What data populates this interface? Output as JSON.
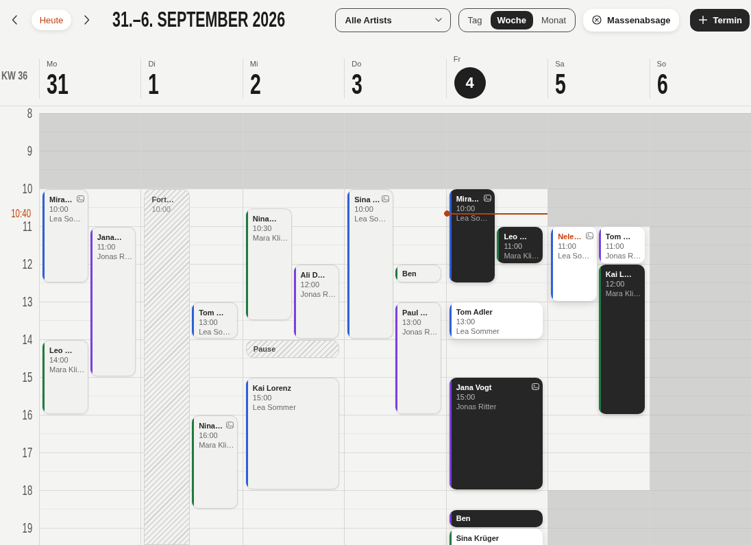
{
  "toolbar": {
    "today_button": "Heute",
    "title": "31.–6. SEPTEMBER 2026",
    "artist_filter": {
      "value": "Alle Artists"
    },
    "views": [
      {
        "label": "Tag",
        "selected": false
      },
      {
        "label": "Woche",
        "selected": true
      },
      {
        "label": "Monat",
        "selected": false
      }
    ],
    "cancel_button": "Massenabsage",
    "add_button": "Termin"
  },
  "week_label": "KW 36",
  "hours": [
    "8",
    "9",
    "10",
    "11",
    "12",
    "13",
    "14",
    "15",
    "16",
    "17",
    "18",
    "19"
  ],
  "now": {
    "label": "10:40"
  },
  "days": [
    {
      "weekday": "Mo",
      "date": "31",
      "selected": false,
      "closed_hours": [
        true,
        true,
        false,
        false,
        false,
        false,
        false,
        false,
        false,
        false,
        false,
        false
      ],
      "events": [
        {
          "kind": "past",
          "title": "Mira…",
          "time": "10:00",
          "artist": "Lea So…",
          "color": "#2d5fd8",
          "photo": true,
          "flagged": false
        },
        {
          "kind": "past",
          "title": "Jana…",
          "time": "11:00",
          "artist": "Jonas R…",
          "color": "#7b3fe0",
          "photo": false,
          "flagged": false
        },
        {
          "kind": "past",
          "title": "Leo …",
          "time": "14:00",
          "artist": "Mara Kli…",
          "color": "#1f7a3f",
          "photo": false,
          "flagged": false
        }
      ]
    },
    {
      "weekday": "Di",
      "date": "1",
      "selected": false,
      "closed_hours": [
        true,
        true,
        false,
        false,
        false,
        false,
        false,
        false,
        false,
        false,
        false,
        false
      ],
      "events": [
        {
          "kind": "blocked",
          "title": "Fort…",
          "time": "10:00",
          "photo": false,
          "flagged": false
        },
        {
          "kind": "past",
          "title": "Tom …",
          "time": "13:00",
          "artist": "Lea So…",
          "color": "#2d5fd8",
          "photo": false,
          "flagged": false
        },
        {
          "kind": "past",
          "title": "Nina…",
          "time": "16:00",
          "artist": "Mara Kli…",
          "color": "#1f7a3f",
          "photo": true,
          "flagged": false
        }
      ]
    },
    {
      "weekday": "Mi",
      "date": "2",
      "selected": false,
      "closed_hours": [
        true,
        true,
        false,
        false,
        false,
        false,
        false,
        false,
        false,
        false,
        false,
        false
      ],
      "events": [
        {
          "kind": "past",
          "title": "Nina…",
          "time": "10:30",
          "artist": "Mara Kli…",
          "color": "#1f7a3f",
          "photo": false,
          "flagged": false
        },
        {
          "kind": "past",
          "title": "Ali D…",
          "time": "12:00",
          "artist": "Jonas R…",
          "color": "#7b3fe0",
          "photo": false,
          "flagged": false
        },
        {
          "kind": "blocked",
          "title": "Pause",
          "photo": false,
          "flagged": false
        },
        {
          "kind": "past",
          "title": "Kai Lorenz",
          "time": "15:00",
          "artist": "Lea Sommer",
          "color": "#2d5fd8",
          "photo": false,
          "flagged": false
        }
      ]
    },
    {
      "weekday": "Do",
      "date": "3",
      "selected": false,
      "closed_hours": [
        true,
        true,
        false,
        false,
        false,
        false,
        false,
        false,
        false,
        false,
        false,
        false
      ],
      "events": [
        {
          "kind": "past",
          "title": "Sina …",
          "time": "10:00",
          "artist": "Lea So…",
          "color": "#2d5fd8",
          "photo": true,
          "flagged": false
        },
        {
          "kind": "past",
          "title": "Ben",
          "color": "#1f7a3f",
          "photo": false,
          "flagged": false
        },
        {
          "kind": "past",
          "title": "Paul …",
          "time": "13:00",
          "artist": "Jonas R…",
          "color": "#7b3fe0",
          "photo": false,
          "flagged": false
        }
      ]
    },
    {
      "weekday": "Fr",
      "date": "4",
      "selected": true,
      "closed_hours": [
        true,
        true,
        false,
        false,
        false,
        false,
        false,
        false,
        false,
        false,
        false,
        false
      ],
      "events": [
        {
          "kind": "confirmed",
          "title": "Mira…",
          "time": "10:00",
          "artist": "Lea So…",
          "color": "#2d5fd8",
          "photo": true,
          "flagged": false
        },
        {
          "kind": "confirmed",
          "title": "Leo …",
          "time": "11:00",
          "artist": "Mara Kli…",
          "color": "#1f7a3f",
          "photo": false,
          "flagged": false
        },
        {
          "kind": "pending",
          "title": "Tom Adler",
          "time": "13:00",
          "artist": "Lea Sommer",
          "color": "#2d5fd8",
          "photo": false,
          "flagged": false
        },
        {
          "kind": "confirmed",
          "title": "Jana Vogt",
          "time": "15:00",
          "artist": "Jonas Ritter",
          "color": "#7b3fe0",
          "photo": true,
          "flagged": false
        },
        {
          "kind": "confirmed",
          "title": "Ben",
          "color": "#7b3fe0",
          "photo": false,
          "flagged": false
        },
        {
          "kind": "pending",
          "title": "Sina Krüger",
          "color": "#1f7a3f",
          "photo": false,
          "flagged": false
        }
      ]
    },
    {
      "weekday": "Sa",
      "date": "5",
      "selected": false,
      "closed_hours": [
        true,
        true,
        true,
        false,
        false,
        false,
        false,
        false,
        false,
        false,
        true,
        true
      ],
      "events": [
        {
          "kind": "pending",
          "title": "Nele…",
          "time": "11:00",
          "artist": "Lea So…",
          "color": "#2d5fd8",
          "photo": true,
          "flagged": true
        },
        {
          "kind": "pending",
          "title": "Tom …",
          "time": "11:00",
          "artist": "Jonas R…",
          "color": "#7b3fe0",
          "photo": false,
          "flagged": false
        },
        {
          "kind": "confirmed",
          "title": "Kai L…",
          "time": "12:00",
          "artist": "Mara Kli…",
          "color": "#1f7a3f",
          "photo": false,
          "flagged": false
        }
      ]
    },
    {
      "weekday": "So",
      "date": "6",
      "selected": false,
      "closed_hours": [
        true,
        true,
        true,
        true,
        true,
        true,
        true,
        true,
        true,
        true,
        true,
        true
      ]
    }
  ]
}
